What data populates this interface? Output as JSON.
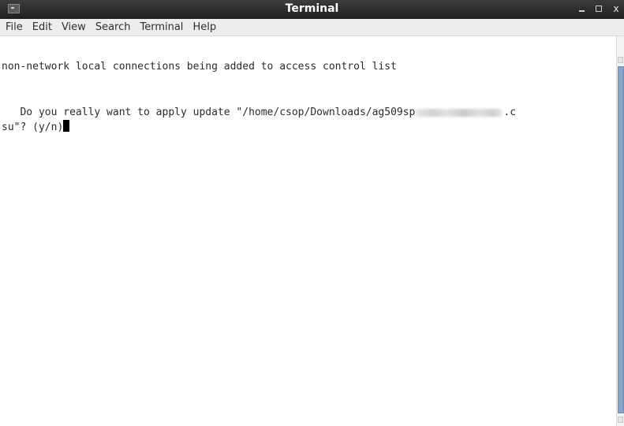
{
  "window": {
    "title": "Terminal",
    "minimize_icon": "minimize-icon",
    "maximize_icon": "maximize-icon",
    "close_label": "x",
    "app_icon": "terminal-icon"
  },
  "menu": {
    "items": [
      "File",
      "Edit",
      "View",
      "Search",
      "Terminal",
      "Help"
    ]
  },
  "terminal": {
    "lines": [
      "non-network local connections being added to access control list",
      "   Do you really want to apply update \"/home/csop/Downloads/ag509sp",
      ".c",
      "su\"? (y/n)"
    ],
    "redacted_region": "blurred-version-text"
  },
  "colors": {
    "titlebar": "#2a2a2a",
    "menubar": "#ededed",
    "scroll_thumb": "#8aa6c6",
    "text": "#2b2b2b"
  }
}
